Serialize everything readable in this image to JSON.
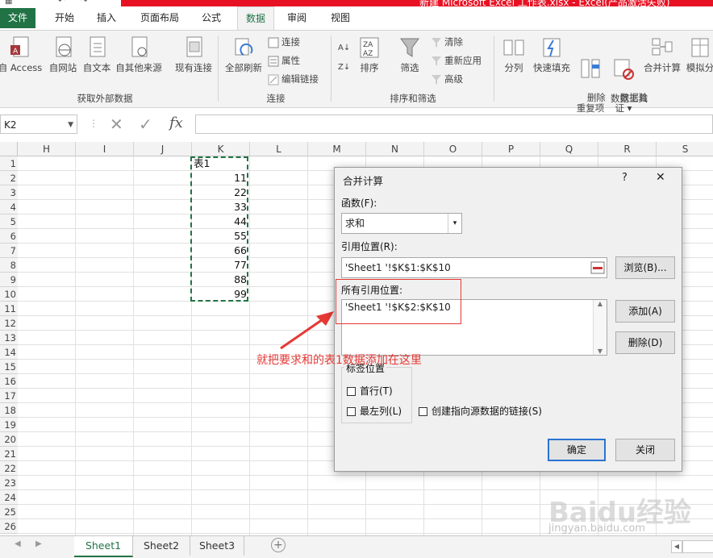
{
  "window": {
    "title_partial": "新建 Microsoft Excel 工作表.xlsx - Excel(产品激活失败)"
  },
  "tabs": [
    {
      "label": "文件"
    },
    {
      "label": "开始"
    },
    {
      "label": "插入"
    },
    {
      "label": "页面布局"
    },
    {
      "label": "公式"
    },
    {
      "label": "数据"
    },
    {
      "label": "审阅"
    },
    {
      "label": "视图"
    }
  ],
  "ribbon": {
    "get_external": {
      "group_label": "获取外部数据",
      "buttons": [
        {
          "label": "自 Access"
        },
        {
          "label": "自网站"
        },
        {
          "label": "自文本"
        },
        {
          "label": "自其他来源"
        },
        {
          "label": "现有连接"
        }
      ]
    },
    "connections": {
      "group_label": "连接",
      "refresh_label": "全部刷新",
      "small": [
        {
          "label": "连接"
        },
        {
          "label": "属性"
        },
        {
          "label": "编辑链接"
        }
      ]
    },
    "sort_filter": {
      "group_label": "排序和筛选",
      "sort_label": "排序",
      "filter_label": "筛选",
      "small": [
        {
          "label": "清除"
        },
        {
          "label": "重新应用"
        },
        {
          "label": "高级"
        }
      ]
    },
    "data_tools": {
      "group_label": "数据工具",
      "buttons": [
        {
          "label": "分列"
        },
        {
          "label": "快速填充"
        },
        {
          "label": "删除\n重复项"
        },
        {
          "label": "数据验\n证 ▾"
        },
        {
          "label": "合并计算"
        },
        {
          "label": "模拟分"
        }
      ]
    }
  },
  "formula_bar": {
    "name_box": "K2",
    "cancel": "✕",
    "enter": "✓",
    "fx": "fx",
    "value": ""
  },
  "grid": {
    "columns": [
      "H",
      "I",
      "J",
      "K",
      "L",
      "M",
      "N",
      "O",
      "P",
      "Q",
      "R",
      "S"
    ],
    "rows": [
      "1",
      "2",
      "3",
      "4",
      "5",
      "6",
      "7",
      "8",
      "9",
      "10",
      "11",
      "12",
      "13",
      "14",
      "15",
      "16",
      "17",
      "18",
      "19",
      "20",
      "21",
      "22",
      "23",
      "24",
      "25",
      "26"
    ],
    "k_header": "表1",
    "k_values": [
      "11",
      "22",
      "33",
      "44",
      "55",
      "66",
      "77",
      "88",
      "99"
    ]
  },
  "sheets": [
    {
      "label": "Sheet1"
    },
    {
      "label": "Sheet2"
    },
    {
      "label": "Sheet3"
    }
  ],
  "dialog": {
    "title": "合并计算",
    "help": "?",
    "close": "✕",
    "function_label": "函数(F):",
    "function_value": "求和",
    "reference_label": "引用位置(R):",
    "reference_value": "'Sheet1 '!$K$1:$K$10",
    "browse": "浏览(B)...",
    "all_refs_label": "所有引用位置:",
    "all_refs": [
      "'Sheet1 '!$K$2:$K$10"
    ],
    "add": "添加(A)",
    "delete": "删除(D)",
    "label_pos": "标签位置",
    "top_row": "首行(T)",
    "left_col": "最左列(L)",
    "create_links": "创建指向源数据的链接(S)",
    "ok": "确定",
    "cancel": "关闭"
  },
  "annotation": {
    "text": "就把要求和的表1数据添加在这里",
    "color": "#e53935"
  },
  "watermark": {
    "line1": "Baidu经验",
    "line2": "jingyan.baidu.com"
  },
  "colors": {
    "excel_green": "#217346",
    "title_red": "#e81123",
    "ok_border": "#2b73d2"
  }
}
